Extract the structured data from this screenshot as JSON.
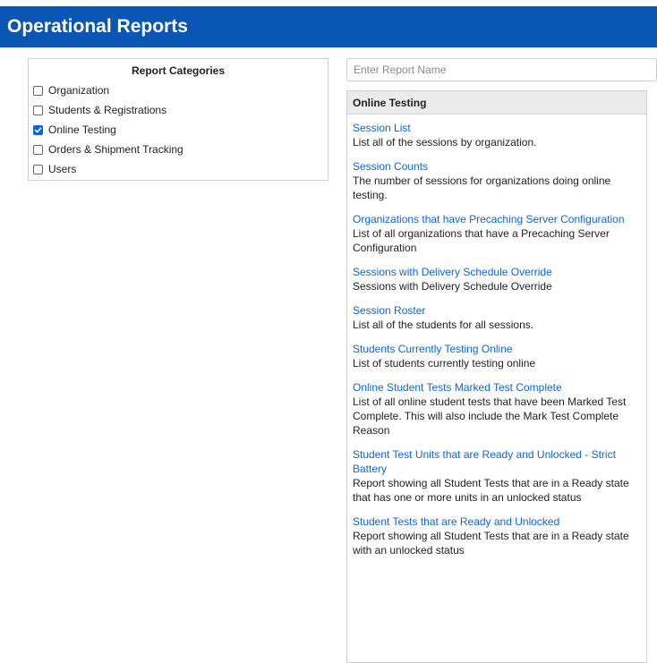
{
  "header": {
    "title": "Operational Reports"
  },
  "categories": {
    "title": "Report Categories",
    "items": [
      {
        "label": "Organization",
        "checked": false
      },
      {
        "label": "Students & Registrations",
        "checked": false
      },
      {
        "label": "Online Testing",
        "checked": true
      },
      {
        "label": "Orders & Shipment Tracking",
        "checked": false
      },
      {
        "label": "Users",
        "checked": false
      }
    ]
  },
  "search": {
    "placeholder": "Enter Report Name",
    "value": ""
  },
  "panel": {
    "title": "Online Testing",
    "reports": [
      {
        "name": "Session List",
        "description": "List all of the sessions by organization."
      },
      {
        "name": "Session Counts",
        "description": "The number of sessions for organizations doing online testing."
      },
      {
        "name": "Organizations that have Precaching Server Configuration",
        "description": "List of all organizations that have a Precaching Server Configuration"
      },
      {
        "name": "Sessions with Delivery Schedule Override",
        "description": "Sessions with Delivery Schedule Override"
      },
      {
        "name": "Session Roster",
        "description": "List all of the students for all sessions."
      },
      {
        "name": "Students Currently Testing Online",
        "description": "List of students currently testing online"
      },
      {
        "name": "Online Student Tests Marked Test Complete",
        "description": "List of all online student tests that have been Marked Test Complete. This will also include the Mark Test Complete Reason"
      },
      {
        "name": "Student Test Units that are Ready and Unlocked - Strict Battery",
        "description": "Report showing all Student Tests that are in a Ready state that has one or more units in an unlocked status"
      },
      {
        "name": "Student Tests that are Ready and Unlocked",
        "description": "Report showing all Student Tests that are in a Ready state with an unlocked status"
      }
    ]
  },
  "colors": {
    "header_bg": "#0a56b5",
    "link": "#0b66d6",
    "checkbox_checked": "#0b66d6"
  }
}
